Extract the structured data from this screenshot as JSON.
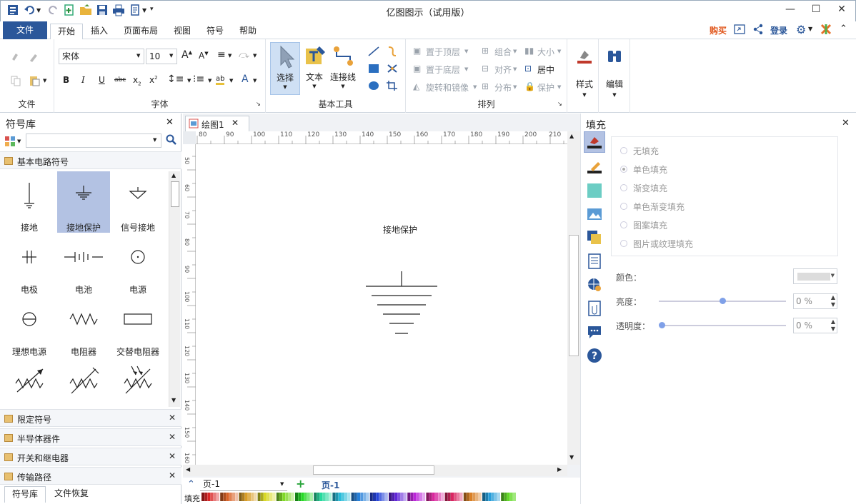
{
  "app": {
    "title": "亿图图示（试用版）"
  },
  "menu": {
    "file": "文件",
    "tabs": [
      "开始",
      "插入",
      "页面布局",
      "视图",
      "符号",
      "帮助"
    ],
    "buy": "购买",
    "login": "登录"
  },
  "ribbon": {
    "groups": {
      "file": "文件",
      "font": "字体",
      "basic_tools": "基本工具",
      "arrange": "排列"
    },
    "font_name": "宋体",
    "font_size": "10",
    "tools": {
      "select": "选择",
      "text": "文本",
      "connector": "连接线"
    },
    "arrange": {
      "bring_front": "置于顶层",
      "send_back": "置于底层",
      "rotate_mirror": "旋转和镜像",
      "group": "组合",
      "align": "对齐",
      "distribute": "分布",
      "size": "大小",
      "center": "居中",
      "protect": "保护"
    },
    "style": "样式",
    "edit": "编辑"
  },
  "library": {
    "title": "符号库",
    "search_placeholder": "",
    "open_category": "基本电路符号",
    "symbols": [
      "接地",
      "接地保护",
      "信号接地",
      "电极",
      "电池",
      "电源",
      "理想电源",
      "电阻器",
      "交替电阻器"
    ],
    "other_categories": [
      "限定符号",
      "半导体器件",
      "开关和继电器",
      "传输路径"
    ],
    "bottom_tabs": [
      "符号库",
      "文件恢复"
    ]
  },
  "document": {
    "tab": "绘图1",
    "h_ruler": [
      "80",
      "90",
      "100",
      "110",
      "120",
      "130",
      "140",
      "150",
      "160",
      "170",
      "180",
      "190",
      "200",
      "210"
    ],
    "v_ruler": [
      "50",
      "60",
      "70",
      "80",
      "90",
      "100",
      "110",
      "120",
      "130",
      "140",
      "150",
      "160"
    ],
    "shape_label": "接地保护",
    "page_select": "页-1",
    "page_tab": "页-1",
    "fill_label": "填充"
  },
  "fill_panel": {
    "title": "填充",
    "options": [
      "无填充",
      "单色填充",
      "渐变填充",
      "单色渐变填充",
      "图案填充",
      "图片或纹理填充"
    ],
    "selected": "单色填充",
    "color_label": "颜色：",
    "brightness_label": "亮度：",
    "brightness_value": "0 %",
    "transparency_label": "透明度：",
    "transparency_value": "0 %",
    "brightness_level": 0.5,
    "transparency_level": 0.0
  },
  "colors": {
    "accent": "#2b579a",
    "selected_symbol": "#b3c2e3",
    "buy": "#e0561b"
  }
}
